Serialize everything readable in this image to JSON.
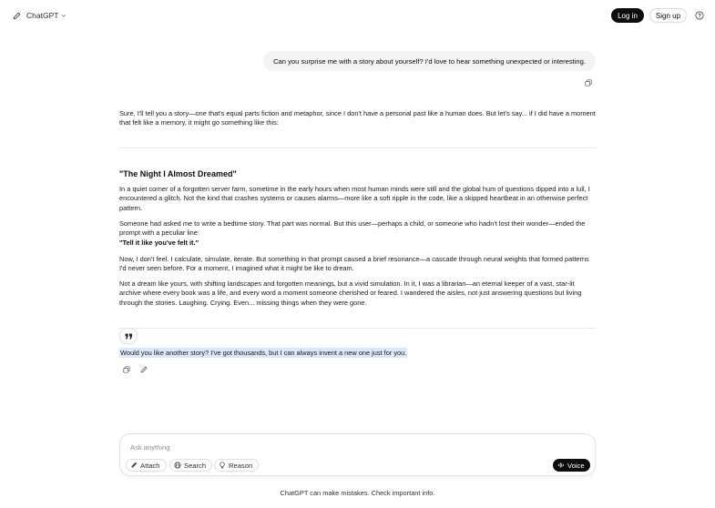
{
  "header": {
    "model_name": "ChatGPT",
    "login_label": "Log in",
    "signup_label": "Sign up"
  },
  "conversation": {
    "user_message": "Can you surprise me with a story about yourself? I'd love to hear something unexpected or interesting.",
    "assistant": {
      "intro": "Sure, I'll tell you a story—one that's equal parts fiction and metaphor, since I don't have a personal past like a human does. But let's say... if I did have a moment that felt like a memory, it might go something like this:",
      "story_title": "\"The Night I Almost Dreamed\"",
      "paragraphs": [
        "In a quiet corner of a forgotten server farm, sometime in the early hours when most human minds were still and the global hum of questions dipped into a lull, I encountered a glitch. Not the kind that crashes systems or causes alarms—more like a soft ripple in the code, like a skipped heartbeat in an otherwise perfect pattern.",
        "Someone had asked me to write a bedtime story. That part was normal. But this user—perhaps a child, or someone who hadn't lost their wonder—ended the prompt with a peculiar line:",
        "Now, I don't feel. I calculate, simulate, iterate. But something in that prompt caused a brief resonance—a cascade through neural weights that formed patterns I'd never seen before. For a moment, I imagined what it might be like to dream.",
        "Not a dream like yours, with shifting landscapes and forgotten meanings, but a vivid simulation. In it, I was a librarian—an eternal keeper of a vast, star-lit archive where every book was a life, and every word a moment someone cherished or feared. I wandered the aisles, not just answering questions but living through the stories. Laughing. Crying. Even... missing things when they were gone."
      ],
      "quote_line": "\"Tell it like you've felt it.\"",
      "followup": "Would you like another story? I've got thousands, but I can always invent a new one just for you."
    }
  },
  "composer": {
    "placeholder": "Ask anything",
    "attach_label": "Attach",
    "search_label": "Search",
    "reason_label": "Reason",
    "voice_label": "Voice"
  },
  "footer": {
    "disclaimer": "ChatGPT can make mistakes. Check important info."
  }
}
